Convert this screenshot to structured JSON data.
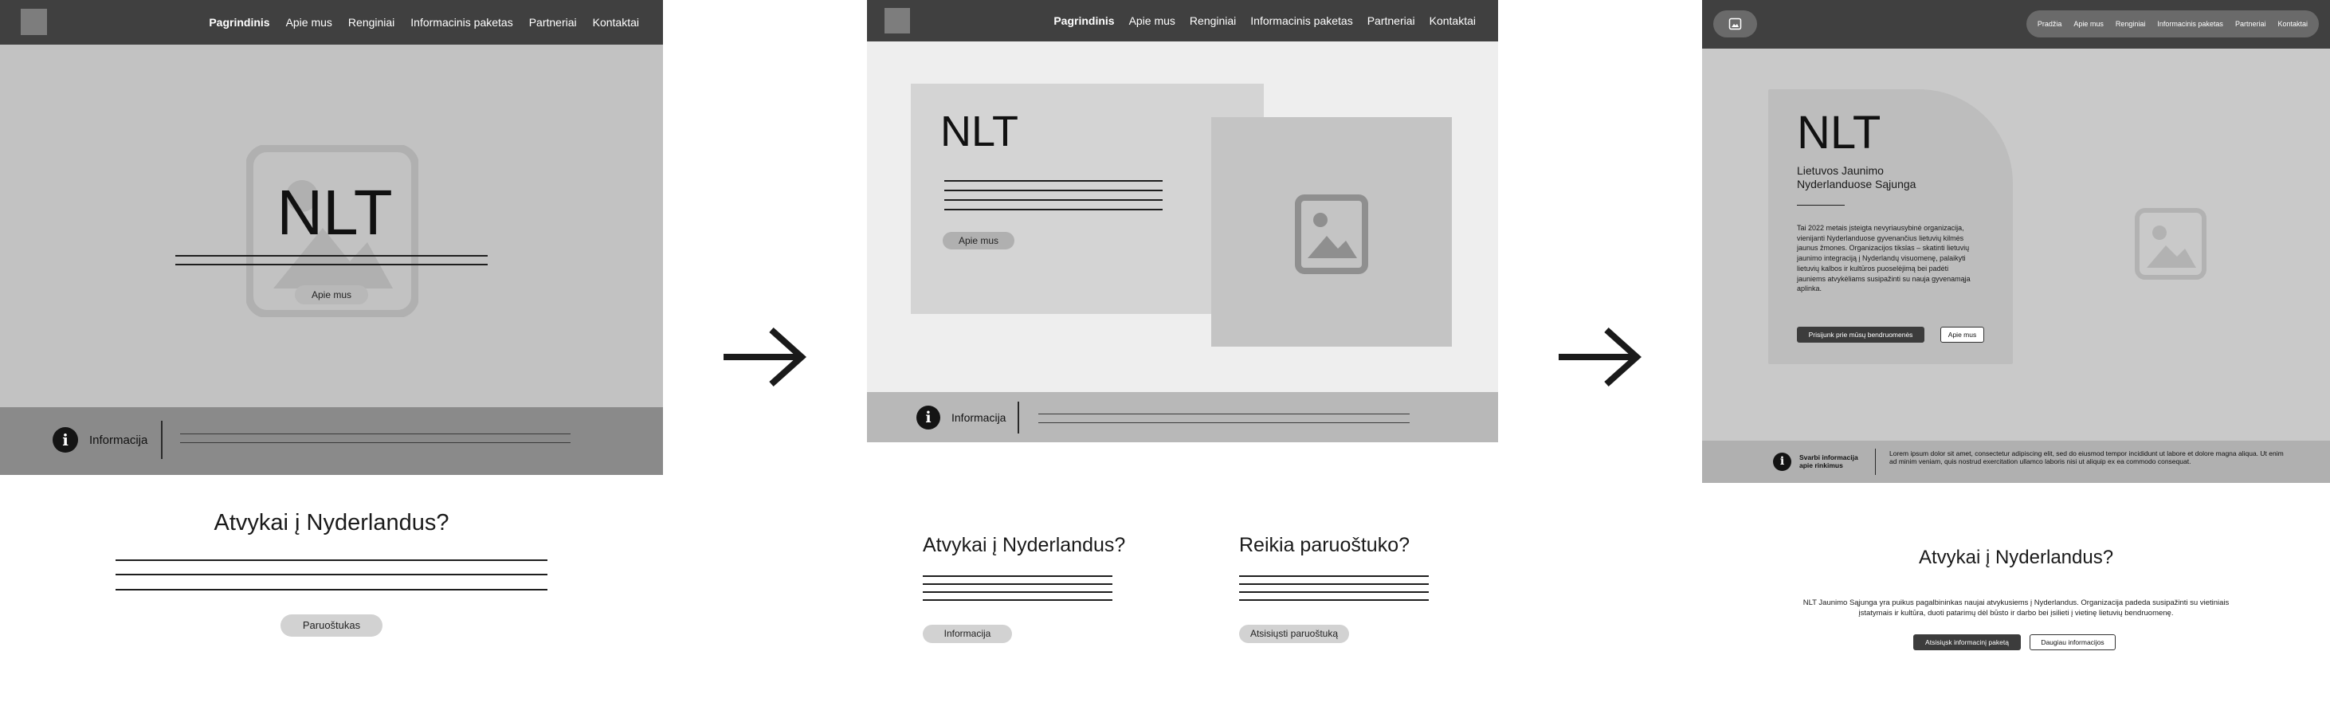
{
  "nav": {
    "items": [
      "Pagrindinis",
      "Apie mus",
      "Renginiai",
      "Informacinis paketas",
      "Partneriai",
      "Kontaktai"
    ],
    "items_v3": [
      "Pradžia",
      "Apie mus",
      "Renginiai",
      "Informacinis paketas",
      "Partneriai",
      "Kontaktai"
    ]
  },
  "hero": {
    "title": "NLT",
    "subtitle": "Lietuvos Jaunimo Nyderlanduose Sąjunga",
    "about_button": "Apie mus",
    "description": "Tai 2022 metais įsteigta nevyriausybinė organizacija, vienijanti Nyderlanduose gyvenančius lietuvių kilmės jaunus žmones. Organizacijos tikslas – skatinti lietuvių jaunimo integraciją į Nyderlandų visuomenę, palaikyti lietuvių kalbos ir kultūros puoselėjimą bei padėti jauniems atvykėliams susipažinti su nauja gyvenamąja aplinka.",
    "join_button": "Prisijunk prie mūsų bendruomenės"
  },
  "info_bar": {
    "label": "Informacija",
    "label_v3": "Svarbi informacija apie rinkimus",
    "text_v3": "Lorem ipsum dolor sit amet, consectetur adipiscing elit, sed do eiusmod tempor incididunt ut labore et dolore magna aliqua. Ut enim ad minim veniam, quis nostrud exercitation ullamco laboris nisi ut aliquip ex ea commodo consequat."
  },
  "arrival": {
    "heading": "Atvykai į Nyderlandus?",
    "button_v1": "Paruoštukas",
    "button_v2": "Informacija",
    "text_v3": "NLT Jaunimo Sąjunga yra puikus pagalbininkas naujai atvykusiems į Nyderlandus. Organizacija padeda susipažinti su vietiniais įstatymais ir kultūra, duoti patarimų dėl būsto ir darbo bei įsilieti į vietinę lietuvių bendruomenę.",
    "download_package_button": "Atsisiųsk informacinį paketą",
    "more_info_button": "Daugiau informacijos"
  },
  "guide": {
    "heading": "Reikia paruoštuko?",
    "button": "Atsisiųsti paruoštuką"
  },
  "icons": {
    "arrow": "arrow-right-icon",
    "info": "info-icon",
    "image": "image-placeholder-icon",
    "logo": "logo-placeholder-icon"
  },
  "colors": {
    "nav_bg": "#404040",
    "hero_bg_v1": "#c2c2c2",
    "info_bar_bg_v1": "#8a8a8a",
    "page_bg_v2": "#eeeeee",
    "card_bg_v2": "#d4d4d4",
    "image_block_v2": "#c4c4c4",
    "info_bar_bg_v2": "#b8b8b8",
    "hero_bg_v3": "#c9c9c9",
    "info_bar_bg_v3": "#b0b0b0",
    "dark_button": "#3c3c3c"
  }
}
